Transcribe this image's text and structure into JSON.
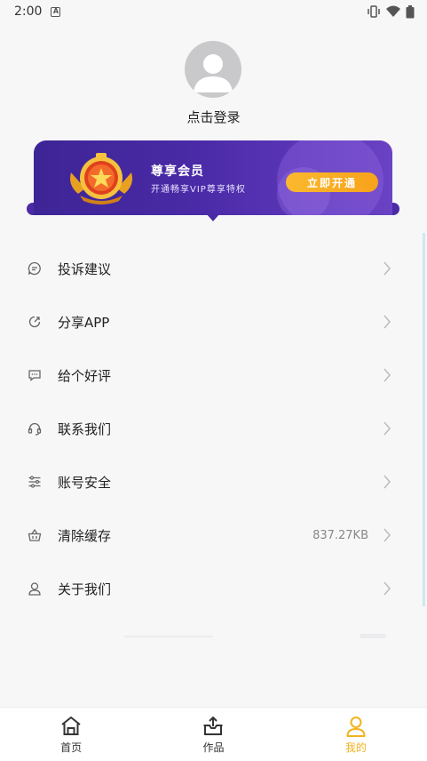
{
  "status_bar": {
    "time": "2:00",
    "notification_icon": "a-icon",
    "icons": [
      "vibrate-icon",
      "wifi-icon",
      "battery-icon"
    ]
  },
  "profile": {
    "login_text": "点击登录"
  },
  "vip": {
    "title": "尊享会员",
    "subtitle": "开通畅享VIP尊享特权",
    "button_label": "立即开通",
    "colors": {
      "banner": "#4a2aa6",
      "button": "#f9a824",
      "badge": "#f2b233"
    }
  },
  "menu": {
    "items": [
      {
        "label": "投诉建议",
        "icon": "chat-icon",
        "value": ""
      },
      {
        "label": "分享APP",
        "icon": "share-icon",
        "value": ""
      },
      {
        "label": "给个好评",
        "icon": "comment-icon",
        "value": ""
      },
      {
        "label": "联系我们",
        "icon": "headset-icon",
        "value": ""
      },
      {
        "label": "账号安全",
        "icon": "sliders-icon",
        "value": ""
      },
      {
        "label": "清除缓存",
        "icon": "basket-icon",
        "value": "837.27KB"
      },
      {
        "label": "关于我们",
        "icon": "user-icon",
        "value": ""
      }
    ]
  },
  "bottom_nav": {
    "items": [
      {
        "label": "首页",
        "icon": "home-icon",
        "active": false
      },
      {
        "label": "作品",
        "icon": "upload-box-icon",
        "active": false
      },
      {
        "label": "我的",
        "icon": "user-icon",
        "active": true
      }
    ],
    "active_color": "#f1b320"
  }
}
